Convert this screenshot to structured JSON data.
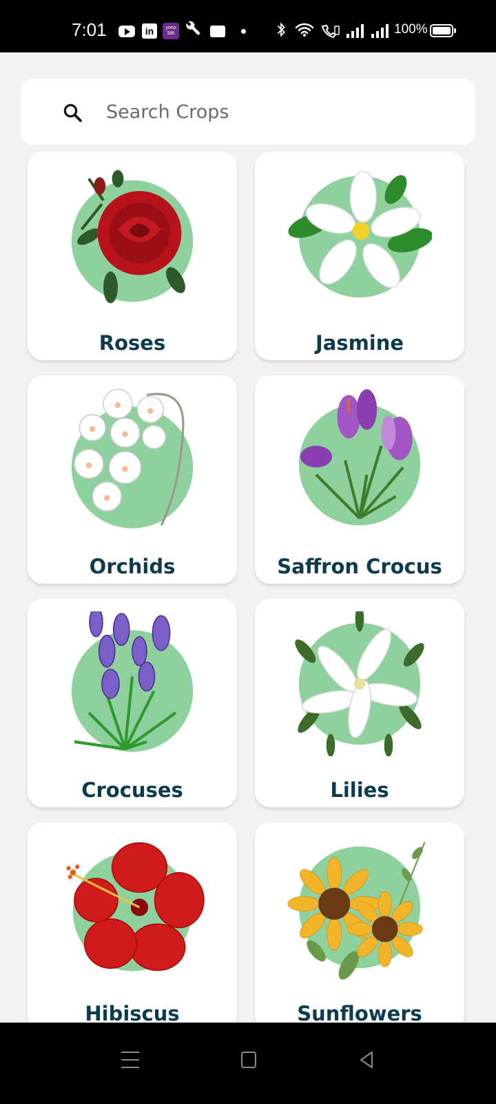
{
  "status_bar": {
    "time": "7:01",
    "battery": "100%",
    "icons": [
      "youtube-icon",
      "linkedin-icon",
      "yono-sbi-icon",
      "wrench-icon",
      "card-icon",
      "dot-icon",
      "bluetooth-icon",
      "wifi-icon",
      "wifi-calling-icon",
      "signal-icon",
      "signal-icon",
      "battery-icon"
    ],
    "yono_text": "yono",
    "yono_sub": "SBI",
    "linkedin_text": "in"
  },
  "search": {
    "placeholder": "Search Crops",
    "value": ""
  },
  "crops": [
    {
      "label": "Roses",
      "icon": "rose-icon"
    },
    {
      "label": "Jasmine",
      "icon": "jasmine-icon"
    },
    {
      "label": "Orchids",
      "icon": "orchid-icon"
    },
    {
      "label": "Saffron Crocus",
      "icon": "saffron-crocus-icon"
    },
    {
      "label": "Crocuses",
      "icon": "crocus-icon"
    },
    {
      "label": "Lilies",
      "icon": "lily-icon"
    },
    {
      "label": "Hibiscus",
      "icon": "hibiscus-icon"
    },
    {
      "label": "Sunflowers",
      "icon": "sunflower-icon"
    }
  ],
  "colors": {
    "background": "#f0f2f4",
    "card": "#ffffff",
    "label": "#0e3a4e",
    "blob": "#8fd19e"
  }
}
